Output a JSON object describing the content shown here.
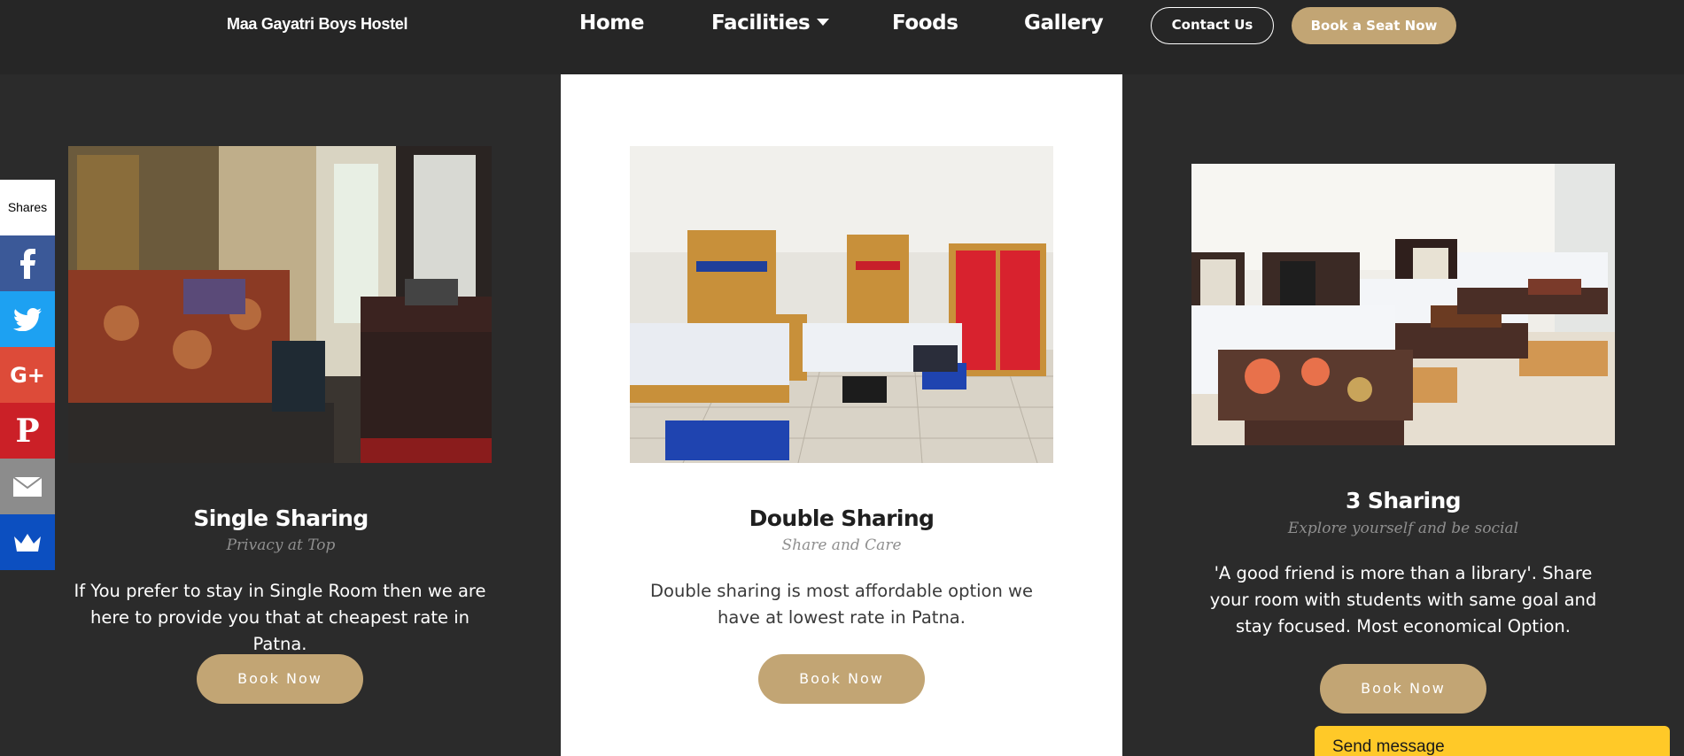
{
  "header": {
    "brand": "Maa Gayatri Boys Hostel",
    "nav": {
      "home": "Home",
      "facilities": "Facilities",
      "foods": "Foods",
      "gallery": "Gallery"
    },
    "contact_label": "Contact Us",
    "book_seat_label": "Book a Seat Now"
  },
  "share_bar": {
    "label": "Shares",
    "icons": [
      "facebook-icon",
      "twitter-icon",
      "google-plus-icon",
      "pinterest-icon",
      "email-icon",
      "sumome-crown-icon"
    ]
  },
  "cards": [
    {
      "title": "Single Sharing",
      "subtitle": "Privacy at Top",
      "description": "If You prefer to stay in Single Room then we are here to provide you that at cheapest rate in Patna.",
      "button": "Book Now"
    },
    {
      "title": "Double Sharing",
      "subtitle": "Share and Care",
      "description": "Double sharing is most affordable option we have at lowest rate in Patna.",
      "button": "Book Now"
    },
    {
      "title": "3 Sharing",
      "subtitle": "Explore yourself and be social",
      "description": "'A good friend is more than a library'. Share your room with students with same goal and stay focused. Most economical Option.",
      "button": "Book Now"
    }
  ],
  "chat": {
    "label": "Send message"
  },
  "colors": {
    "accent": "#c2a574",
    "background": "#2b2b2b",
    "header": "#262626",
    "chat": "#ffc928"
  }
}
